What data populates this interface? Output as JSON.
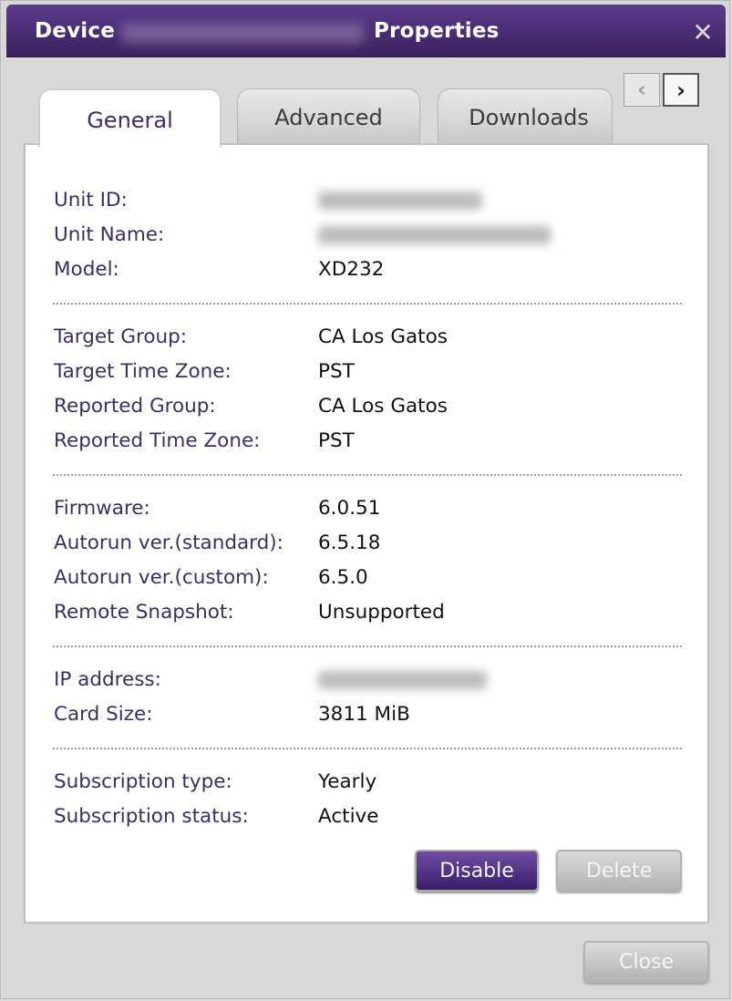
{
  "window": {
    "title_left": "Device",
    "title_right": "Properties",
    "close_icon": "close-icon"
  },
  "tabs": [
    {
      "label": "General",
      "active": true
    },
    {
      "label": "Advanced",
      "active": false
    },
    {
      "label": "Downloads",
      "active": false
    }
  ],
  "nav": {
    "prev_icon": "chevron-left-icon",
    "next_icon": "chevron-right-icon",
    "prev_glyph": "‹",
    "next_glyph": "›"
  },
  "general": {
    "unit_id_label": "Unit ID:",
    "unit_name_label": "Unit Name:",
    "model_label": "Model:",
    "model_value": "XD232",
    "target_group_label": "Target Group:",
    "target_group_value": "CA Los Gatos",
    "target_tz_label": "Target Time Zone:",
    "target_tz_value": "PST",
    "reported_group_label": "Reported Group:",
    "reported_group_value": "CA Los Gatos",
    "reported_tz_label": "Reported Time Zone:",
    "reported_tz_value": "PST",
    "firmware_label": "Firmware:",
    "firmware_value": "6.0.51",
    "autorun_std_label": "Autorun ver.(standard):",
    "autorun_std_value": "6.5.18",
    "autorun_custom_label": "Autorun ver.(custom):",
    "autorun_custom_value": "6.5.0",
    "remote_snapshot_label": "Remote Snapshot:",
    "remote_snapshot_value": "Unsupported",
    "ip_label": "IP address:",
    "card_size_label": "Card Size:",
    "card_size_value": "3811 MiB",
    "sub_type_label": "Subscription type:",
    "sub_type_value": "Yearly",
    "sub_status_label": "Subscription status:",
    "sub_status_value": "Active"
  },
  "buttons": {
    "disable": "Disable",
    "delete": "Delete",
    "close": "Close"
  },
  "colors": {
    "title_bar": "#4a2f78",
    "label_text": "#3b2f62",
    "primary_button": "#4d2f80"
  }
}
